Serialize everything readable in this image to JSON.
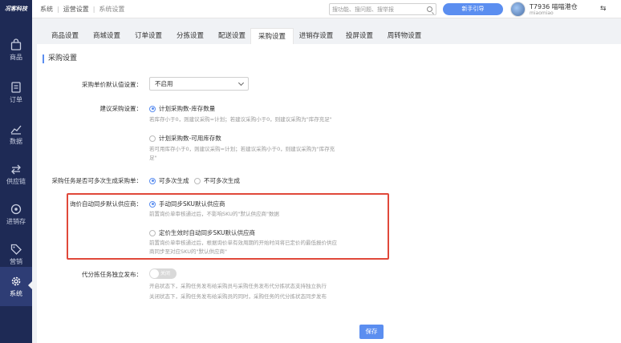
{
  "header": {
    "logo_text": "况客科技",
    "breadcrumbs": [
      "系统",
      "运营设置",
      "系统设置"
    ],
    "search_placeholder": "搜功能、搜问题、搜举报",
    "guide_button": "新手引导",
    "user_name": "T7936 喵喵港仓",
    "user_sub": "miaomiao",
    "switch_glyph": "⇆"
  },
  "sidebar": {
    "items": [
      {
        "label": "商品",
        "icon": "bag-icon"
      },
      {
        "label": "订单",
        "icon": "order-icon"
      },
      {
        "label": "数据",
        "icon": "chart-icon"
      },
      {
        "label": "供应链",
        "icon": "swap-icon"
      },
      {
        "label": "进销存",
        "icon": "inventory-icon"
      },
      {
        "label": "营销",
        "icon": "tag-icon"
      },
      {
        "label": "系统",
        "icon": "gear-icon",
        "active": true
      }
    ]
  },
  "tabs": [
    "商品设置",
    "商城设置",
    "订单设置",
    "分拣设置",
    "配送设置",
    "采购设置",
    "进销存设置",
    "投屏设置",
    "周转物设置"
  ],
  "active_tab": "采购设置",
  "form": {
    "section_title": "采购设置",
    "unit_price_label": "采购单价默认值设置：",
    "unit_price_value": "不启用",
    "suggest_label": "建议采购设置：",
    "suggest_opt1": "计划采购数-库存数量",
    "suggest_opt1_desc": "若库存小于0，则建议采购=计划；若建议采购小于0，则建议采购为\"库存充足\"",
    "suggest_opt2": "计划采购数-可用库存数",
    "suggest_opt2_desc_1": "若可用库存小于0，则建议采购=计划；若建议采购小于0，则建议采购为\"库存充",
    "suggest_opt2_desc_2": "足\"",
    "multi_label": "采购任务是否可多次生成采购单：",
    "multi_opt1": "可多次生成",
    "multi_opt2": "不可多次生成",
    "inquiry_label": "询价自动同步默认供应商：",
    "inquiry_opt1": "手动同步SKU默认供应商",
    "inquiry_opt1_desc": "前置询价单审核通过后，不影响SKU的\"默认供应商\"数据",
    "inquiry_opt2": "定价生效时自动同步SKU默认供应商",
    "inquiry_opt2_desc_1": "前置询价单审核通过后，根据询价单有效周期的开始时间将已定价的最低报价供应",
    "inquiry_opt2_desc_2": "商同步至对应SKU的\"默认供应商\"",
    "independent_label": "代分拣任务独立发布：",
    "toggle_text": "关闭",
    "independent_desc_1": "开启状态下，采购任务发布给采购员与采购任务发布代分拣状态支持独立执行",
    "independent_desc_2": "关闭状态下，采购任务发布给采购员的同时，采购任务的代分拣状态同步发布",
    "save_button": "保存"
  },
  "colors": {
    "sidebar_bg": "#1e2a55",
    "accent": "#5b8ef0",
    "highlight_border": "#e0483a"
  }
}
